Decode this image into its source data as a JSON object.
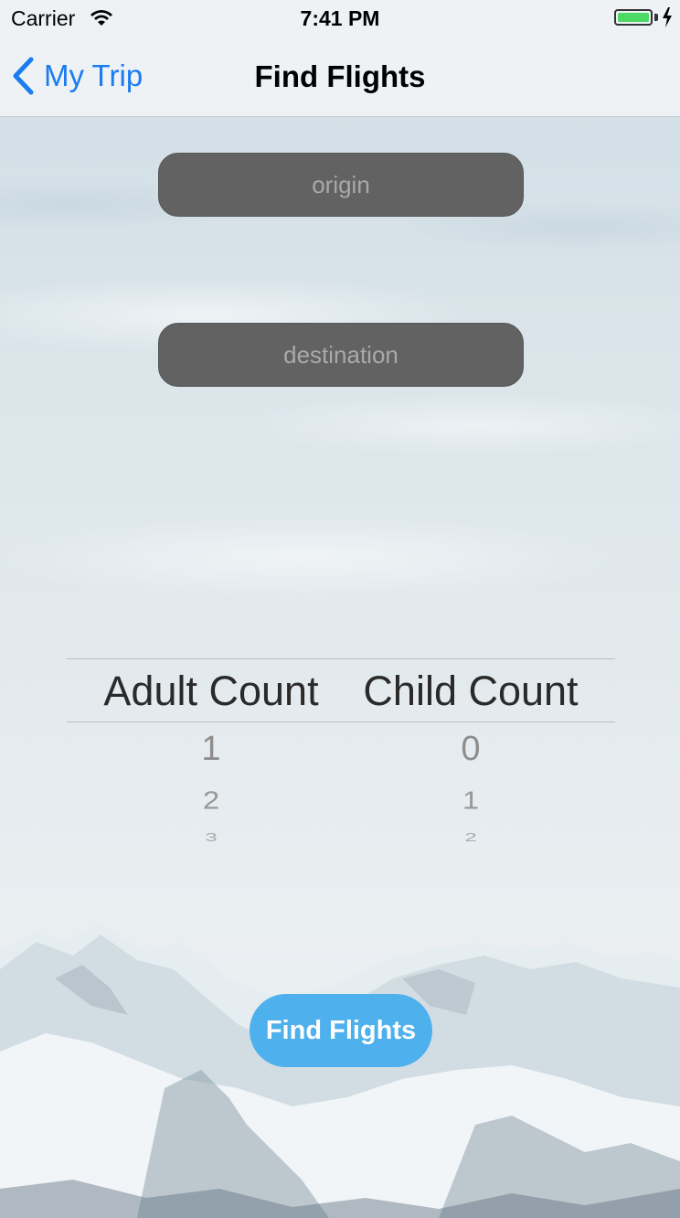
{
  "status_bar": {
    "carrier": "Carrier",
    "time": "7:41 PM"
  },
  "nav": {
    "back_label": "My Trip",
    "title": "Find Flights"
  },
  "form": {
    "origin_placeholder": "origin",
    "destination_placeholder": "destination"
  },
  "picker": {
    "columns": [
      {
        "header": "Adult Count",
        "values": [
          "1",
          "2",
          "3"
        ]
      },
      {
        "header": "Child Count",
        "values": [
          "0",
          "1",
          "2"
        ]
      }
    ]
  },
  "action": {
    "find_label": "Find Flights",
    "color": "#4eb0ec"
  },
  "colors": {
    "accent": "#1a7cf0",
    "input_background": "#626262",
    "battery": "#4cd964"
  }
}
